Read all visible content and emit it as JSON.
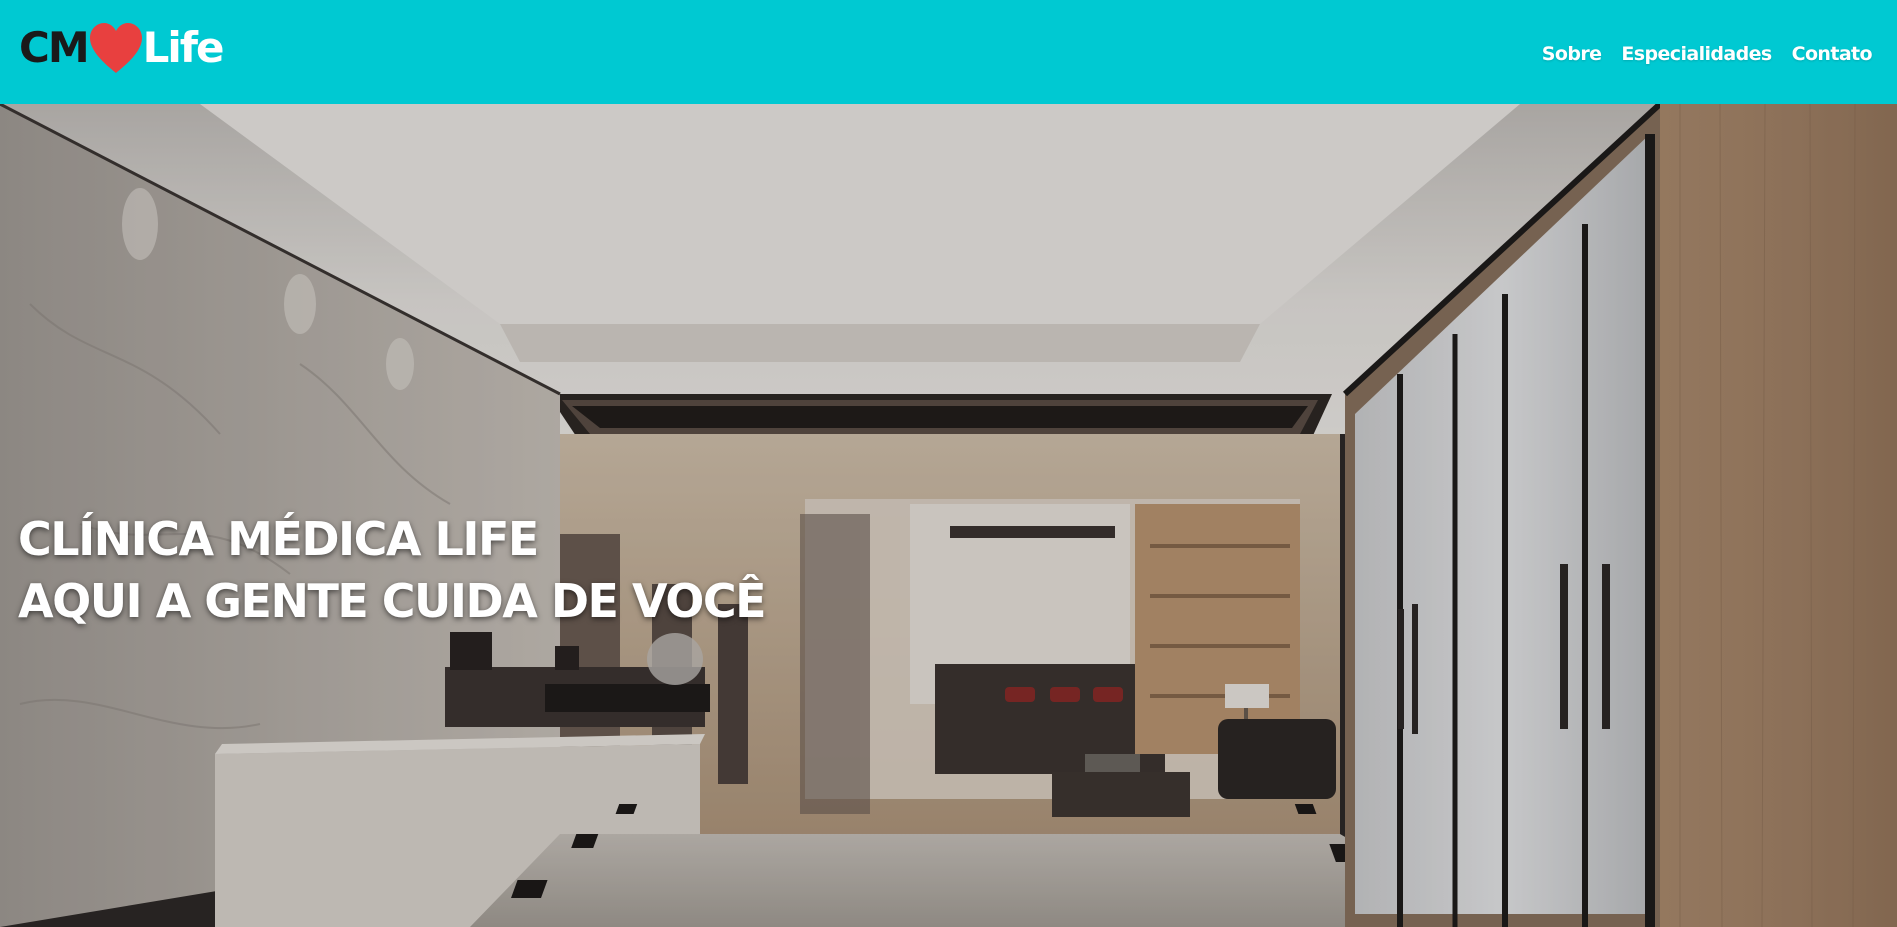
{
  "brand": {
    "logo_left": "CM",
    "logo_right": "Life",
    "heart_color": "#e8403f"
  },
  "nav": {
    "items": [
      {
        "label": "Sobre"
      },
      {
        "label": "Especialidades"
      },
      {
        "label": "Contato"
      }
    ]
  },
  "hero": {
    "line1": "CLÍNICA MÉDICA LIFE",
    "line2": "AQUI A GENTE CUIDA DE VOCÊ"
  },
  "theme": {
    "header_bg": "#00c9d2"
  }
}
